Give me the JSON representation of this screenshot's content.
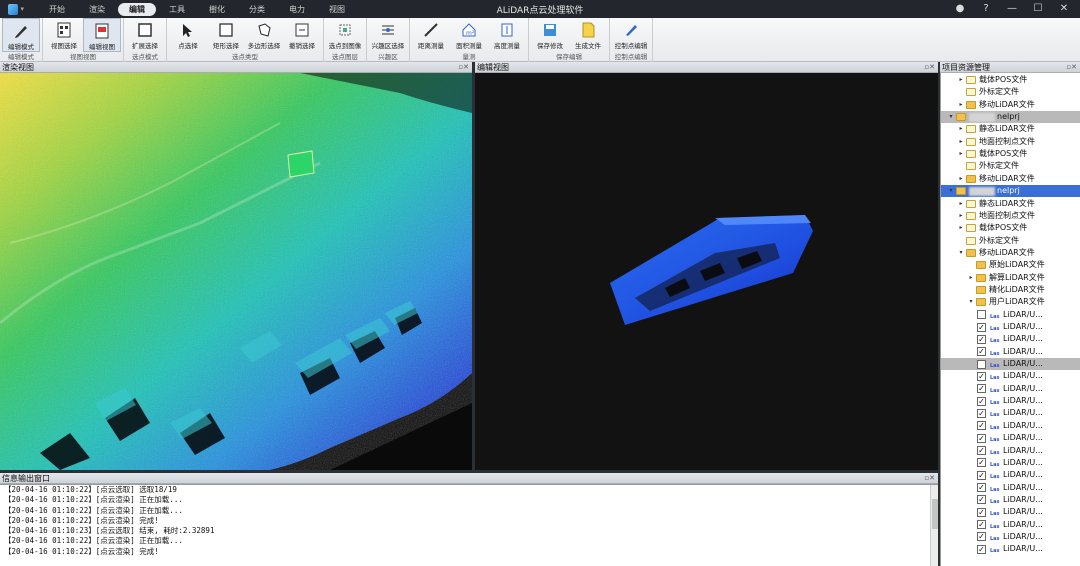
{
  "app": {
    "title": "ALiDAR点云处理软件"
  },
  "menu": {
    "tabs": [
      {
        "label": "开始"
      },
      {
        "label": "渲染"
      },
      {
        "label": "编辑",
        "active": true
      },
      {
        "label": "工具"
      },
      {
        "label": "樹化"
      },
      {
        "label": "分类"
      },
      {
        "label": "电力"
      },
      {
        "label": "视图"
      }
    ]
  },
  "ribbon": {
    "groups": [
      {
        "label": "编辑模式",
        "buttons": [
          {
            "label": "编辑模式",
            "icon": "pen-icon",
            "selected": true
          }
        ]
      },
      {
        "label": "视图视图",
        "buttons": [
          {
            "label": "视图选择",
            "icon": "doc-grid-icon"
          },
          {
            "label": "编辑视图",
            "icon": "doc-red-icon",
            "selected": true
          }
        ]
      },
      {
        "label": "选点模式",
        "buttons": [
          {
            "label": "扩展选择",
            "icon": "expand-select-icon"
          }
        ]
      },
      {
        "label": "选点类型",
        "buttons": [
          {
            "label": "点选择",
            "icon": "cursor-icon"
          },
          {
            "label": "矩形选择",
            "icon": "rect-icon"
          },
          {
            "label": "多边形选择",
            "icon": "polygon-icon"
          },
          {
            "label": "撤销选择",
            "icon": "undo-select-icon"
          }
        ]
      },
      {
        "label": "选点图层",
        "buttons": [
          {
            "label": "选点到图像",
            "icon": "layer-select-icon"
          }
        ]
      },
      {
        "label": "兴趣区",
        "buttons": [
          {
            "label": "兴趣区选择",
            "icon": "roi-icon"
          }
        ]
      },
      {
        "label": "量测",
        "buttons": [
          {
            "label": "距离测量",
            "icon": "ruler-icon"
          },
          {
            "label": "面积测量",
            "icon": "area-icon"
          },
          {
            "label": "高度测量",
            "icon": "height-icon"
          }
        ]
      },
      {
        "label": "保存编辑",
        "buttons": [
          {
            "label": "保存修改",
            "icon": "save-icon"
          },
          {
            "label": "生成文件",
            "icon": "file-gen-icon"
          }
        ]
      },
      {
        "label": "控制点编辑",
        "buttons": [
          {
            "label": "控制点编辑",
            "icon": "control-edit-icon"
          }
        ]
      }
    ]
  },
  "panels": {
    "render_view": "渲染视图",
    "edit_view": "编辑视图",
    "project": "项目资源管理",
    "output": "信息输出窗口"
  },
  "tree": {
    "rows": [
      {
        "indent": 2,
        "expander": "▸",
        "icon": "file",
        "label": "载体POS文件"
      },
      {
        "indent": 2,
        "expander": "",
        "icon": "file",
        "label": "外标定文件"
      },
      {
        "indent": 2,
        "expander": "▸",
        "icon": "folder",
        "label": "移动LiDAR文件"
      },
      {
        "indent": 0,
        "expander": "▾",
        "icon": "folder",
        "label": "nelprj",
        "blurred": true,
        "highlight": "gray"
      },
      {
        "indent": 2,
        "expander": "▸",
        "icon": "file",
        "label": "静态LiDAR文件"
      },
      {
        "indent": 2,
        "expander": "▸",
        "icon": "file",
        "label": "地面控制点文件"
      },
      {
        "indent": 2,
        "expander": "▸",
        "icon": "file",
        "label": "载体POS文件"
      },
      {
        "indent": 2,
        "expander": "",
        "icon": "file",
        "label": "外标定文件"
      },
      {
        "indent": 2,
        "expander": "▸",
        "icon": "folder",
        "label": "移动LiDAR文件"
      },
      {
        "indent": 0,
        "expander": "▾",
        "icon": "folder",
        "label": "nelprj",
        "blurred": true,
        "highlight": "blue"
      },
      {
        "indent": 2,
        "expander": "▸",
        "icon": "file",
        "label": "静态LiDAR文件"
      },
      {
        "indent": 2,
        "expander": "▸",
        "icon": "file",
        "label": "地面控制点文件"
      },
      {
        "indent": 2,
        "expander": "▸",
        "icon": "file",
        "label": "载体POS文件"
      },
      {
        "indent": 2,
        "expander": "",
        "icon": "file",
        "label": "外标定文件"
      },
      {
        "indent": 2,
        "expander": "▾",
        "icon": "folder",
        "label": "移动LiDAR文件"
      },
      {
        "indent": 4,
        "expander": "",
        "icon": "folder",
        "label": "原始LiDAR文件"
      },
      {
        "indent": 4,
        "expander": "▸",
        "icon": "folder",
        "label": "解算LiDAR文件"
      },
      {
        "indent": 4,
        "expander": "",
        "icon": "folder",
        "label": "精化LiDAR文件"
      },
      {
        "indent": 4,
        "expander": "▾",
        "icon": "folder",
        "label": "用户LiDAR文件"
      },
      {
        "indent": 6,
        "check": false,
        "icon": "las",
        "label": "LiDAR/U..."
      },
      {
        "indent": 6,
        "check": true,
        "icon": "las",
        "label": "LiDAR/U..."
      },
      {
        "indent": 6,
        "check": true,
        "icon": "las",
        "label": "LiDAR/U..."
      },
      {
        "indent": 6,
        "check": true,
        "icon": "las",
        "label": "LiDAR/U..."
      },
      {
        "indent": 6,
        "check": false,
        "icon": "las",
        "label": "LiDAR/U...",
        "highlight": "gray"
      },
      {
        "indent": 6,
        "check": true,
        "icon": "las",
        "label": "LiDAR/U..."
      },
      {
        "indent": 6,
        "check": true,
        "icon": "las",
        "label": "LiDAR/U..."
      },
      {
        "indent": 6,
        "check": true,
        "icon": "las",
        "label": "LiDAR/U..."
      },
      {
        "indent": 6,
        "check": true,
        "icon": "las",
        "label": "LiDAR/U..."
      },
      {
        "indent": 6,
        "check": true,
        "icon": "las",
        "label": "LiDAR/U..."
      },
      {
        "indent": 6,
        "check": true,
        "icon": "las",
        "label": "LiDAR/U..."
      },
      {
        "indent": 6,
        "check": true,
        "icon": "las",
        "label": "LiDAR/U..."
      },
      {
        "indent": 6,
        "check": true,
        "icon": "las",
        "label": "LiDAR/U..."
      },
      {
        "indent": 6,
        "check": true,
        "icon": "las",
        "label": "LiDAR/U..."
      },
      {
        "indent": 6,
        "check": true,
        "icon": "las",
        "label": "LiDAR/U..."
      },
      {
        "indent": 6,
        "check": true,
        "icon": "las",
        "label": "LiDAR/U..."
      },
      {
        "indent": 6,
        "check": true,
        "icon": "las",
        "label": "LiDAR/U..."
      },
      {
        "indent": 6,
        "check": true,
        "icon": "las",
        "label": "LiDAR/U..."
      },
      {
        "indent": 6,
        "check": true,
        "icon": "las",
        "label": "LiDAR/U..."
      },
      {
        "indent": 6,
        "check": true,
        "icon": "las",
        "label": "LiDAR/U..."
      }
    ]
  },
  "log": [
    "【20-04-16 01:10:22】[点云选取] 选取18/19",
    "【20-04-16 01:10:22】[点云渲染] 正在加载...",
    "【20-04-16 01:10:22】[点云渲染] 正在加载...",
    "【20-04-16 01:10:22】[点云渲染] 完成!",
    "【20-04-16 01:10:23】[点云选取] 结束, 耗时:2.32891",
    "【20-04-16 01:10:22】[点云渲染] 正在加载...",
    "【20-04-16 01:10:22】[点云渲染] 完成!"
  ],
  "colors": {
    "accent": "#3b6fd6",
    "highlight_gray": "#b9b9b9"
  }
}
